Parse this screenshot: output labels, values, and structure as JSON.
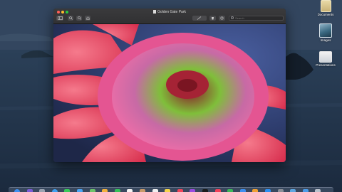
{
  "window": {
    "title": "Golden Gate Park",
    "search_placeholder": "Search"
  },
  "toolbar": {
    "sidebar_icon": "sidebar-icon",
    "zoom_out_icon": "zoom-out-icon",
    "zoom_in_icon": "zoom-in-icon",
    "share_icon": "share-icon",
    "markup_icon": "markup-pen-icon",
    "fill_icon": "fill-icon",
    "rotate_icon": "rotate-icon"
  },
  "desktop_icons": [
    {
      "label": "Documents",
      "icon": "documents-stack-icon"
    },
    {
      "label": "Images",
      "icon": "images-stack-icon"
    },
    {
      "label": "Presentations",
      "icon": "presentations-stack-icon"
    }
  ],
  "photo": {
    "subject": "pink coneflower",
    "colors": {
      "petal": "#f0507a",
      "center": "#6fae3a",
      "background": "#2f3d66"
    }
  },
  "dock": {
    "apps": [
      {
        "icon": "finder-icon",
        "color": "#3f8ff0"
      },
      {
        "icon": "siri-icon",
        "color": "#7b5cd6"
      },
      {
        "icon": "launchpad-icon",
        "color": "#9aa3b1"
      },
      {
        "icon": "safari-icon",
        "color": "#3ea0f0"
      },
      {
        "icon": "messages-icon",
        "color": "#37c95a"
      },
      {
        "icon": "mail-icon",
        "color": "#4aa5f5"
      },
      {
        "icon": "maps-icon",
        "color": "#6cc36a"
      },
      {
        "icon": "photos-icon",
        "color": "#f2b13c"
      },
      {
        "icon": "facetime-icon",
        "color": "#35c15a"
      },
      {
        "icon": "calendar-icon",
        "color": "#f4f4f4"
      },
      {
        "icon": "contacts-icon",
        "color": "#c89a6a"
      },
      {
        "icon": "reminders-icon",
        "color": "#f0f0f0"
      },
      {
        "icon": "notes-icon",
        "color": "#f5d44a"
      },
      {
        "icon": "music-icon",
        "color": "#f0455a"
      },
      {
        "icon": "podcasts-icon",
        "color": "#9a4ce0"
      },
      {
        "icon": "tv-icon",
        "color": "#1c1c1c"
      },
      {
        "icon": "news-icon",
        "color": "#f04058"
      },
      {
        "icon": "numbers-icon",
        "color": "#3cb85a"
      },
      {
        "icon": "keynote-icon",
        "color": "#3d8ff0"
      },
      {
        "icon": "pages-icon",
        "color": "#f0a032"
      },
      {
        "icon": "app-store-icon",
        "color": "#2d8ff2"
      },
      {
        "icon": "system-preferences-icon",
        "color": "#8a8f98"
      },
      {
        "icon": "preview-icon",
        "color": "#5fa6e0"
      },
      {
        "icon": "downloads-icon",
        "color": "#4b9be8"
      },
      {
        "icon": "trash-icon",
        "color": "#b9c1cc"
      }
    ]
  }
}
